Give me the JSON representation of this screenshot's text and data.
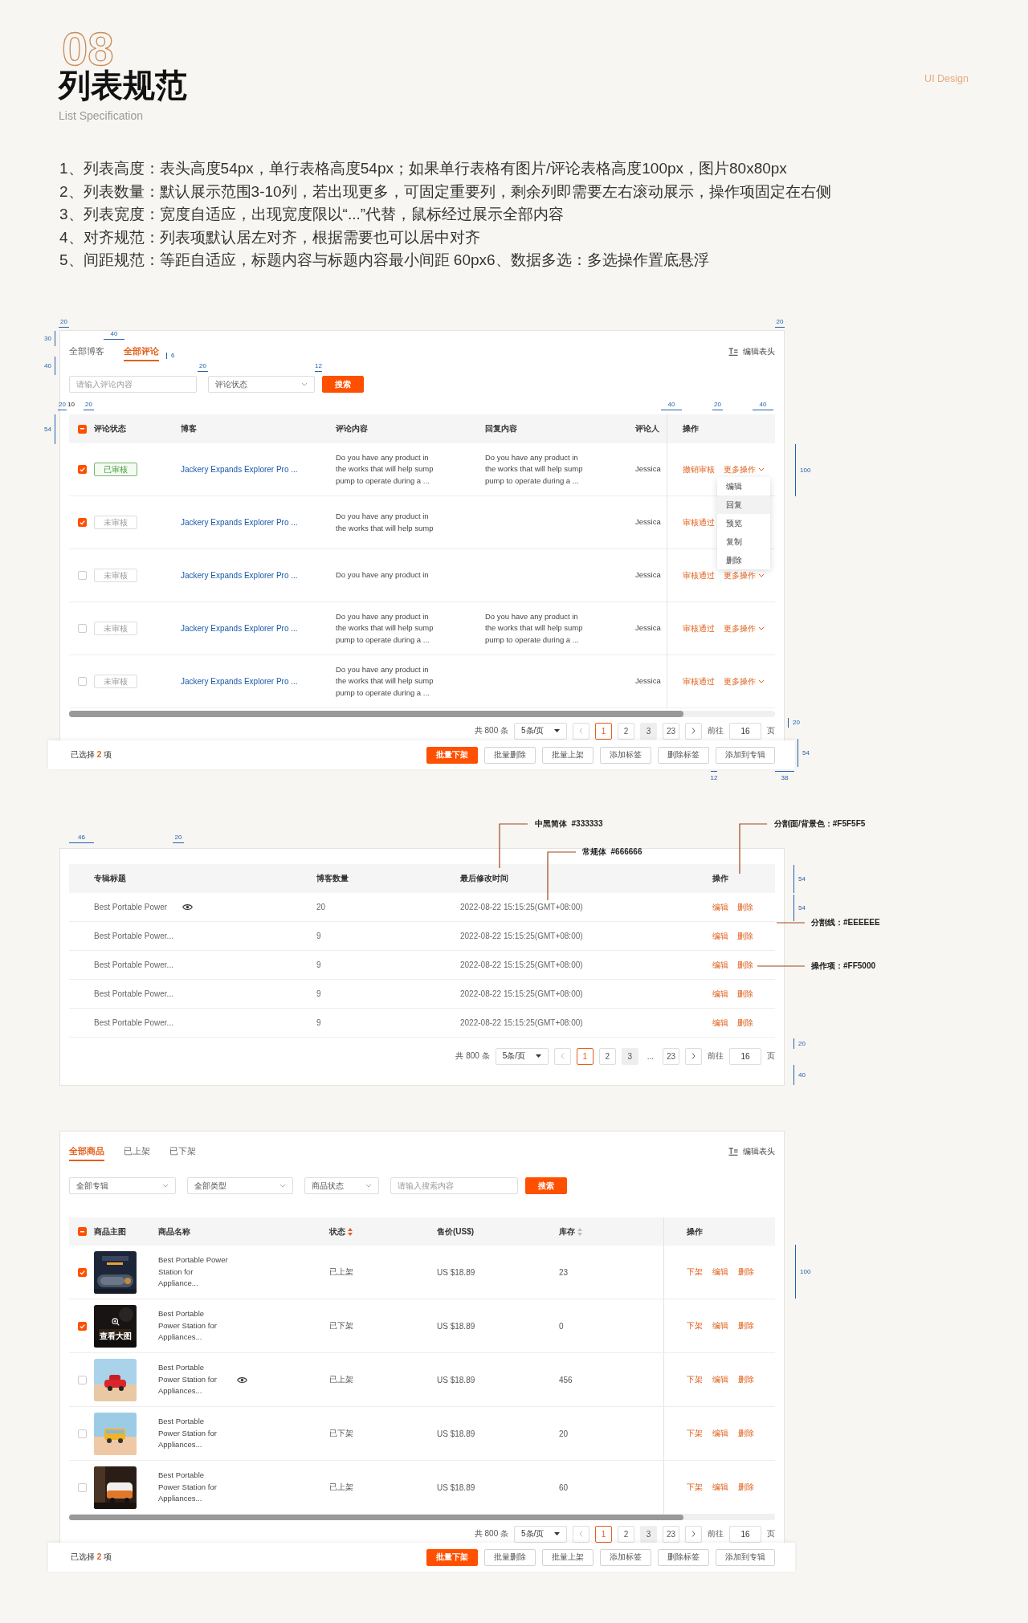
{
  "header": {
    "number": "08",
    "title": "列表规范",
    "subtitle": "List Specification",
    "tag": "UI Design"
  },
  "rules": [
    "1、列表高度：表头高度54px，单行表格高度54px；如果单行表格有图片/评论表格高度100px，图片80x80px",
    "2、列表数量：默认展示范围3-10列，若出现更多，可固定重要列，剩余列即需要左右滚动展示，操作项固定在右侧",
    "3、列表宽度：宽度自适应，出现宽度限以“...”代替，鼠标经过展示全部内容",
    "4、对齐规范：列表项默认居左对齐，根据需要也可以居中对齐",
    "5、间距规范：等距自适应，标题内容与标题内容最小间距 60px6、数据多选：多选操作置底悬浮"
  ],
  "comment_section": {
    "tabs": [
      {
        "label": "全部博客",
        "selected": false
      },
      {
        "label": "全部评论",
        "selected": true
      }
    ],
    "edit_columns": "编辑表头",
    "search_field": {
      "placeholder": "请输入评论内容"
    },
    "status_select": {
      "placeholder": "评论状态"
    },
    "search_button": "搜索",
    "select_all": {
      "indeterminate": true
    },
    "columns": [
      "评论状态",
      "博客",
      "评论内容",
      "回复内容",
      "评论人",
      "操作"
    ],
    "rows": [
      {
        "checked": true,
        "status": "已审核",
        "approved": true,
        "blog": "Jackery Expands Explorer Pro ...",
        "comment": "Do you have any product in\nthe works that will help sump\npump to operate during a ...",
        "reply": "Do you have any product in\nthe works that will help sump\npump to operate during a ...",
        "commenter": "Jessica",
        "actions": [
          {
            "label": "撤销审核",
            "kind": "link"
          },
          {
            "label": "更多操作",
            "kind": "menu"
          }
        ]
      },
      {
        "checked": true,
        "status": "未审核",
        "approved": false,
        "blog": "Jackery Expands Explorer Pro ...",
        "comment": "Do you have any product in\nthe works that will help sump",
        "commenter": "Jessica",
        "actions": [
          {
            "label": "审核通过",
            "kind": "link"
          }
        ]
      },
      {
        "checked": false,
        "status": "未审核",
        "approved": false,
        "blog": "Jackery Expands Explorer Pro ...",
        "comment": "Do you have any product in",
        "commenter": "Jessica",
        "actions": [
          {
            "label": "审核通过",
            "kind": "link"
          },
          {
            "label": "更多操作",
            "kind": "menu"
          }
        ]
      },
      {
        "checked": false,
        "status": "未审核",
        "approved": false,
        "blog": "Jackery Expands Explorer Pro ...",
        "comment": "Do you have any product in\nthe works that will help sump\npump to operate during a ...",
        "reply": "Do you have any product in\nthe works that will help sump\npump to operate during a ...",
        "commenter": "Jessica",
        "actions": [
          {
            "label": "审核通过",
            "kind": "link"
          },
          {
            "label": "更多操作",
            "kind": "menu"
          }
        ]
      },
      {
        "checked": false,
        "status": "未审核",
        "approved": false,
        "blog": "Jackery Expands Explorer Pro ...",
        "comment": "Do you have any product in\nthe works that will help sump\npump to operate during a ...",
        "commenter": "Jessica",
        "actions": [
          {
            "label": "审核通过",
            "kind": "link"
          },
          {
            "label": "更多操作",
            "kind": "menu"
          }
        ]
      }
    ],
    "menu": {
      "items": [
        {
          "label": "编辑",
          "hovered": false
        },
        {
          "label": "回复",
          "hovered": true
        },
        {
          "label": "预览",
          "hovered": false
        },
        {
          "label": "复制",
          "hovered": false
        },
        {
          "label": "删除",
          "hovered": false
        }
      ]
    },
    "pagination": {
      "total": "共 800 条",
      "page_size": "5条/页",
      "pages": [
        {
          "label": "1",
          "selected": true,
          "hovered": false
        },
        {
          "label": "2",
          "selected": false,
          "hovered": false
        },
        {
          "label": "3",
          "selected": false,
          "hovered": true
        },
        {
          "label": "23",
          "selected": false,
          "hovered": false
        }
      ],
      "goto_label": "前往",
      "goto_value": "16",
      "page_unit": "页"
    },
    "selection_bar": {
      "text": "已选择 **2** 项",
      "buttons": [
        {
          "label": "批量下架",
          "primary": true
        },
        {
          "label": "批量删除",
          "primary": false
        },
        {
          "label": "批量上架",
          "primary": false
        },
        {
          "label": "添加标签",
          "primary": false
        },
        {
          "label": "删除标签",
          "primary": false
        },
        {
          "label": "添加到专辑",
          "primary": false
        }
      ]
    },
    "annotations": [
      {
        "text": "20",
        "kind": "under"
      },
      {
        "text": "20",
        "kind": "under"
      },
      {
        "text": "30",
        "kind": "right"
      },
      {
        "text": "40",
        "kind": "under"
      },
      {
        "text": "6",
        "kind": "left"
      },
      {
        "text": "40",
        "kind": "right"
      },
      {
        "text": "20",
        "kind": "under"
      },
      {
        "text": "12",
        "kind": "under"
      },
      {
        "text": "20",
        "kind": "under"
      },
      {
        "text": "10",
        "kind": "plain"
      },
      {
        "text": "20",
        "kind": "under"
      },
      {
        "text": "54",
        "kind": "right"
      },
      {
        "text": "40",
        "kind": "under"
      },
      {
        "text": "20",
        "kind": "under"
      },
      {
        "text": "40",
        "kind": "under"
      },
      {
        "text": "100",
        "kind": "left"
      },
      {
        "text": "20",
        "kind": "left"
      },
      {
        "text": "54",
        "kind": "left"
      },
      {
        "text": "12",
        "kind": "over"
      },
      {
        "text": "38",
        "kind": "over"
      }
    ]
  },
  "album_section": {
    "columns": [
      "专辑标题",
      "博客数量",
      "最后修改时间",
      "操作"
    ],
    "rows": [
      {
        "title": "Best Portable Power",
        "preview_icon": true,
        "count": "20",
        "time": "2022-08-22 15:15:25(GMT+08:00)",
        "actions": [
          "编辑",
          "删除"
        ]
      },
      {
        "title": "Best Portable Power...",
        "preview_icon": false,
        "count": "9",
        "time": "2022-08-22 15:15:25(GMT+08:00)",
        "actions": [
          "编辑",
          "删除"
        ]
      },
      {
        "title": "Best Portable Power...",
        "preview_icon": false,
        "count": "9",
        "time": "2022-08-22 15:15:25(GMT+08:00)",
        "actions": [
          "编辑",
          "删除"
        ]
      },
      {
        "title": "Best Portable Power...",
        "preview_icon": false,
        "count": "9",
        "time": "2022-08-22 15:15:25(GMT+08:00)",
        "actions": [
          "编辑",
          "删除"
        ]
      },
      {
        "title": "Best Portable Power...",
        "preview_icon": false,
        "count": "9",
        "time": "2022-08-22 15:15:25(GMT+08:00)",
        "actions": [
          "编辑",
          "删除"
        ]
      }
    ],
    "pagination": {
      "total": "共 800 条",
      "page_size": "5条/页",
      "pages": [
        {
          "label": "1",
          "selected": true,
          "hovered": false
        },
        {
          "label": "2",
          "selected": false,
          "hovered": false
        },
        {
          "label": "3",
          "selected": false,
          "hovered": true
        },
        {
          "label": "23",
          "selected": false,
          "hovered": false
        }
      ],
      "ellipsis": "...",
      "goto_label": "前往",
      "goto_value": "16",
      "page_unit": "页"
    },
    "annotations": [
      {
        "text": "46",
        "kind": "under"
      },
      {
        "text": "20",
        "kind": "under"
      },
      {
        "text": "中黑简体  #333333",
        "kind": "leader"
      },
      {
        "text": "常规体  #666666",
        "kind": "leader"
      },
      {
        "text": "分割面/背景色：#F5F5F5",
        "kind": "leader"
      },
      {
        "text": "54",
        "kind": "left"
      },
      {
        "text": "54",
        "kind": "left"
      },
      {
        "text": "分割线：#EEEEEE",
        "kind": "leader"
      },
      {
        "text": "操作项：#FF5000",
        "kind": "leader"
      },
      {
        "text": "20",
        "kind": "left"
      },
      {
        "text": "40",
        "kind": "left"
      }
    ]
  },
  "product_section": {
    "tabs": [
      {
        "label": "全部商品",
        "selected": true
      },
      {
        "label": "已上架",
        "selected": false
      },
      {
        "label": "已下架",
        "selected": false
      }
    ],
    "edit_columns": "编辑表头",
    "filters": [
      {
        "placeholder": "全部专辑"
      },
      {
        "placeholder": "全部类型"
      },
      {
        "placeholder": "商品状态"
      }
    ],
    "search_field": {
      "placeholder": "请输入搜索内容"
    },
    "search_button": "搜索",
    "select_all": {
      "indeterminate": true
    },
    "columns": [
      {
        "label": "商品主图",
        "sortable": false
      },
      {
        "label": "商品名称",
        "sortable": false
      },
      {
        "label": "状态",
        "sortable": true,
        "sort_active": true
      },
      {
        "label": "售价(US$)",
        "sortable": false
      },
      {
        "label": "库存",
        "sortable": true,
        "sort_active": false
      },
      {
        "label": "操作",
        "sortable": false
      }
    ],
    "rows": [
      {
        "checked": true,
        "name": "Best Portable Power\nStation for\nAppliance...",
        "preview_icon": false,
        "status": "已上架",
        "price": "US $18.89",
        "stock": "23",
        "actions": [
          "下架",
          "编辑",
          "删除"
        ]
      },
      {
        "checked": true,
        "preview_label": "查看大图",
        "name": "Best Portable\nPower Station for\nAppliances...",
        "preview_icon": false,
        "status": "已下架",
        "price": "US $18.89",
        "stock": "0",
        "actions": [
          "下架",
          "编辑",
          "删除"
        ]
      },
      {
        "checked": false,
        "name": "Best Portable\nPower Station for\nAppliances...",
        "preview_icon": true,
        "status": "已上架",
        "price": "US $18.89",
        "stock": "456",
        "actions": [
          "下架",
          "编辑",
          "删除"
        ]
      },
      {
        "checked": false,
        "name": "Best Portable\nPower Station for\nAppliances...",
        "preview_icon": false,
        "status": "已下架",
        "price": "US $18.89",
        "stock": "20",
        "actions": [
          "下架",
          "编辑",
          "删除"
        ]
      },
      {
        "checked": false,
        "name": "Best Portable\nPower Station for\nAppliances...",
        "preview_icon": false,
        "status": "已上架",
        "price": "US $18.89",
        "stock": "60",
        "actions": [
          "下架",
          "编辑",
          "删除"
        ]
      }
    ],
    "pagination": {
      "total": "共 800 条",
      "page_size": "5条/页",
      "pages": [
        {
          "label": "1",
          "selected": true,
          "hovered": false
        },
        {
          "label": "2",
          "selected": false,
          "hovered": false
        },
        {
          "label": "3",
          "selected": false,
          "hovered": true
        },
        {
          "label": "23",
          "selected": false,
          "hovered": false
        }
      ],
      "goto_label": "前往",
      "goto_value": "16",
      "page_unit": "页"
    },
    "selection_bar": {
      "text": "已选择 **2** 项",
      "buttons": [
        {
          "label": "批量下架",
          "primary": true
        },
        {
          "label": "批量删除",
          "primary": false
        },
        {
          "label": "批量上架",
          "primary": false
        },
        {
          "label": "添加标签",
          "primary": false
        },
        {
          "label": "删除标签",
          "primary": false
        },
        {
          "label": "添加到专辑",
          "primary": false
        }
      ]
    },
    "annotations": [
      {
        "text": "100",
        "kind": "left"
      }
    ]
  }
}
